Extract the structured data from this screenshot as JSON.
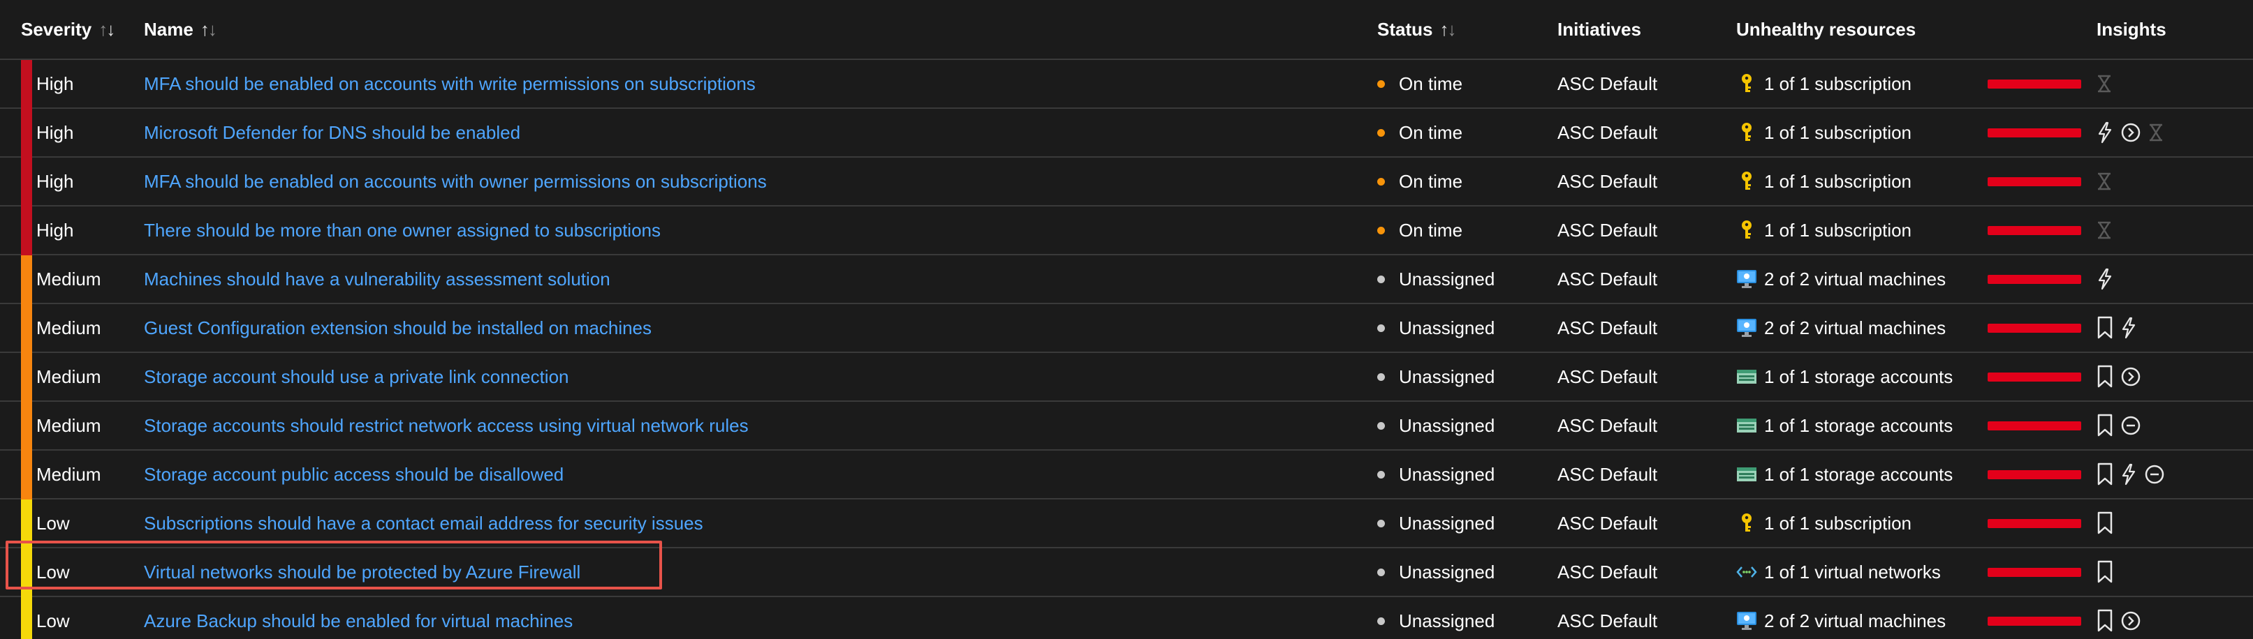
{
  "columns": {
    "severity": "Severity",
    "name": "Name",
    "status": "Status",
    "initiatives": "Initiatives",
    "unhealthy": "Unhealthy resources",
    "insights": "Insights"
  },
  "colors": {
    "high": "#c30f1f",
    "medium": "#f7850f",
    "low": "#f5d90a",
    "on_time_dot": "#f7940a",
    "unassigned_dot": "#c8c8c8",
    "link": "#4fa6ff",
    "unhealthy_bar": "#e3001a",
    "highlight": "#e8534a"
  },
  "rows": [
    {
      "severity": "High",
      "name": "MFA should be enabled on accounts with write permissions on subscriptions",
      "status": "On time",
      "initiative": "ASC Default",
      "resource_icon": "key-icon",
      "resources": "1 of 1 subscription",
      "insights": [
        "hourglass-icon"
      ]
    },
    {
      "severity": "High",
      "name": "Microsoft Defender for DNS should be enabled",
      "status": "On time",
      "initiative": "ASC Default",
      "resource_icon": "key-icon",
      "resources": "1 of 1 subscription",
      "insights": [
        "lightning-icon",
        "arrow-circle-icon",
        "hourglass-icon"
      ]
    },
    {
      "severity": "High",
      "name": "MFA should be enabled on accounts with owner permissions on subscriptions",
      "status": "On time",
      "initiative": "ASC Default",
      "resource_icon": "key-icon",
      "resources": "1 of 1 subscription",
      "insights": [
        "hourglass-icon"
      ]
    },
    {
      "severity": "High",
      "name": "There should be more than one owner assigned to subscriptions",
      "status": "On time",
      "initiative": "ASC Default",
      "resource_icon": "key-icon",
      "resources": "1 of 1 subscription",
      "insights": [
        "hourglass-icon"
      ]
    },
    {
      "severity": "Medium",
      "name": "Machines should have a vulnerability assessment solution",
      "status": "Unassigned",
      "initiative": "ASC Default",
      "resource_icon": "monitor-icon",
      "resources": "2 of 2 virtual machines",
      "insights": [
        "lightning-icon"
      ]
    },
    {
      "severity": "Medium",
      "name": "Guest Configuration extension should be installed on machines",
      "status": "Unassigned",
      "initiative": "ASC Default",
      "resource_icon": "monitor-icon",
      "resources": "2 of 2 virtual machines",
      "insights": [
        "bookmark-icon",
        "lightning-icon"
      ]
    },
    {
      "severity": "Medium",
      "name": "Storage account should use a private link connection",
      "status": "Unassigned",
      "initiative": "ASC Default",
      "resource_icon": "storage-icon",
      "resources": "1 of 1 storage accounts",
      "insights": [
        "bookmark-icon",
        "arrow-circle-icon"
      ]
    },
    {
      "severity": "Medium",
      "name": "Storage accounts should restrict network access using virtual network rules",
      "status": "Unassigned",
      "initiative": "ASC Default",
      "resource_icon": "storage-icon",
      "resources": "1 of 1 storage accounts",
      "insights": [
        "bookmark-icon",
        "minus-circle-icon"
      ]
    },
    {
      "severity": "Medium",
      "name": "Storage account public access should be disallowed",
      "status": "Unassigned",
      "initiative": "ASC Default",
      "resource_icon": "storage-icon",
      "resources": "1 of 1 storage accounts",
      "insights": [
        "bookmark-icon",
        "lightning-icon",
        "minus-circle-icon"
      ]
    },
    {
      "severity": "Low",
      "name": "Subscriptions should have a contact email address for security issues",
      "status": "Unassigned",
      "initiative": "ASC Default",
      "resource_icon": "key-icon",
      "resources": "1 of 1 subscription",
      "insights": [
        "bookmark-icon"
      ]
    },
    {
      "severity": "Low",
      "name": "Virtual networks should be protected by Azure Firewall",
      "status": "Unassigned",
      "initiative": "ASC Default",
      "resource_icon": "vnet-icon",
      "resources": "1 of 1 virtual networks",
      "insights": [
        "bookmark-icon"
      ]
    },
    {
      "severity": "Low",
      "name": "Azure Backup should be enabled for virtual machines",
      "status": "Unassigned",
      "initiative": "ASC Default",
      "resource_icon": "monitor-icon",
      "resources": "2 of 2 virtual machines",
      "insights": [
        "bookmark-icon",
        "arrow-circle-icon"
      ]
    }
  ]
}
